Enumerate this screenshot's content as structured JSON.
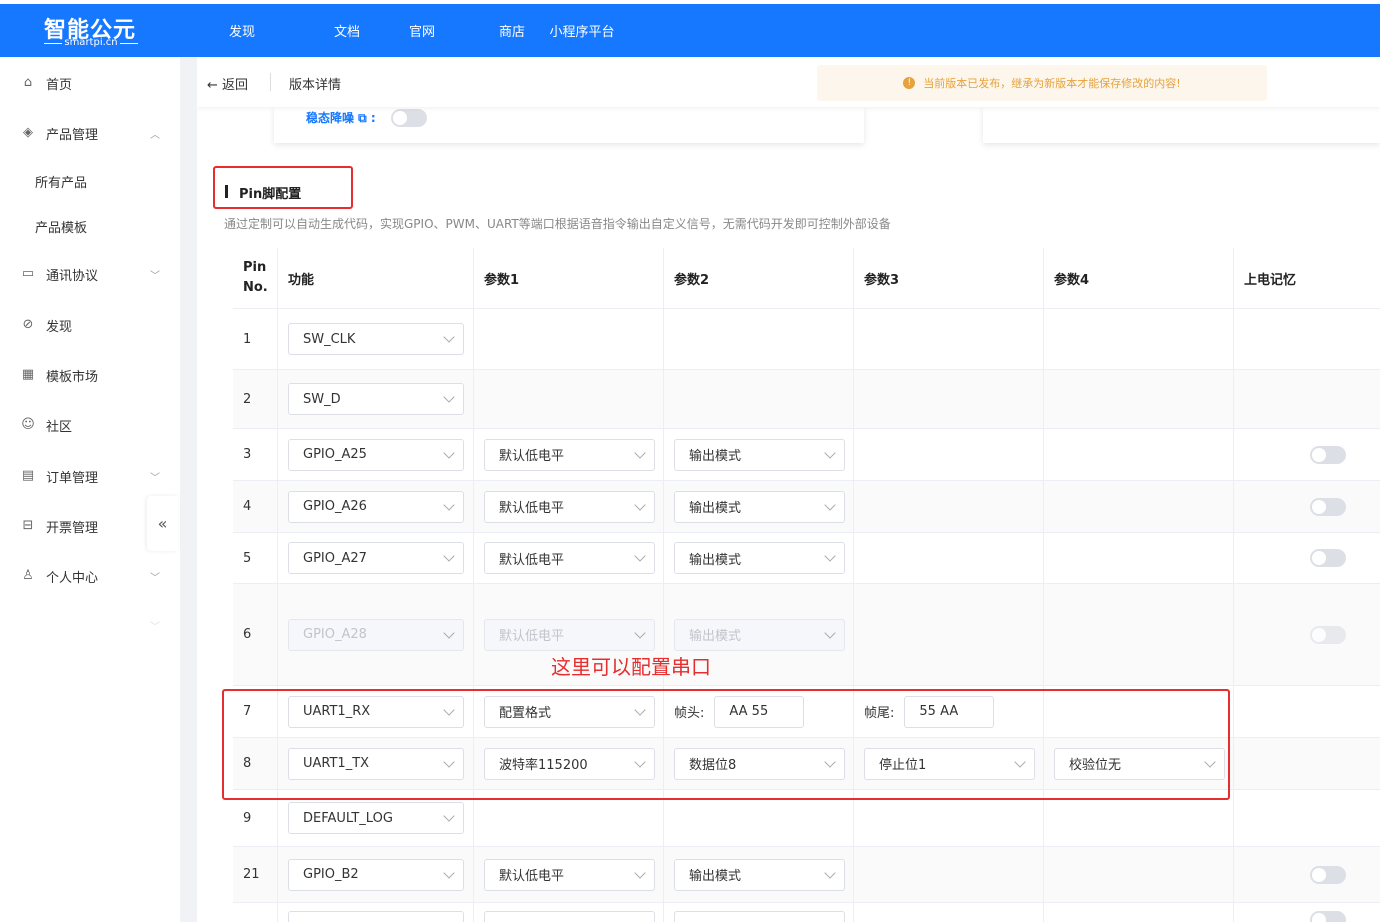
{
  "logo": {
    "main": "智能公元",
    "sub": "smartpi.cn"
  },
  "topnav": [
    "发现",
    "文档",
    "官网",
    "商店",
    "小程序平台"
  ],
  "sidebar": {
    "items": [
      {
        "label": "首页",
        "icon": "home-icon"
      },
      {
        "label": "产品管理",
        "icon": "layers-icon"
      },
      {
        "label": "所有产品"
      },
      {
        "label": "产品模板"
      },
      {
        "label": "通讯协议",
        "icon": "protocol-icon"
      },
      {
        "label": "发现",
        "icon": "compass-icon"
      },
      {
        "label": "模板市场",
        "icon": "grid-icon"
      },
      {
        "label": "社区",
        "icon": "chat-icon"
      },
      {
        "label": "订单管理",
        "icon": "order-icon"
      },
      {
        "label": "开票管理",
        "icon": "invoice-icon"
      },
      {
        "label": "个人中心",
        "icon": "user-icon"
      }
    ]
  },
  "header": {
    "back": "返回",
    "title": "版本详情",
    "notice": "当前版本已发布，继承为新版本才能保存修改的内容!"
  },
  "noise": {
    "label": "稳态降噪 ⧉ :"
  },
  "section": {
    "title": "Pin脚配置",
    "desc": "通过定制可以自动生成代码，实现GPIO、PWM、UART等端口根据语音指令输出自定义信号，无需代码开发即可控制外部设备"
  },
  "table": {
    "headers": {
      "pin": "Pin No.",
      "fn": "功能",
      "p1": "参数1",
      "p2": "参数2",
      "p3": "参数3",
      "p4": "参数4",
      "mem": "上电记忆"
    },
    "rows": [
      {
        "pin": "1",
        "fn": "SW_CLK"
      },
      {
        "pin": "2",
        "fn": "SW_D"
      },
      {
        "pin": "3",
        "fn": "GPIO_A25",
        "p1": "默认低电平",
        "p2": "输出模式"
      },
      {
        "pin": "4",
        "fn": "GPIO_A26",
        "p1": "默认低电平",
        "p2": "输出模式"
      },
      {
        "pin": "5",
        "fn": "GPIO_A27",
        "p1": "默认低电平",
        "p2": "输出模式"
      },
      {
        "pin": "6",
        "fn": "GPIO_A28",
        "p1": "默认低电平",
        "p2": "输出模式"
      },
      {
        "pin": "7",
        "fn": "UART1_RX",
        "p1": "配置格式",
        "p2_label": "帧头:",
        "p2_value": "AA 55",
        "p3_label": "帧尾:",
        "p3_value": "55 AA"
      },
      {
        "pin": "8",
        "fn": "UART1_TX",
        "p1": "波特率115200",
        "p2": "数据位8",
        "p3": "停止位1",
        "p4": "校验位无"
      },
      {
        "pin": "9",
        "fn": "DEFAULT_LOG"
      },
      {
        "pin": "21",
        "fn": "GPIO_B2",
        "p1": "默认低电平",
        "p2": "输出模式"
      }
    ]
  },
  "annotation": "这里可以配置串口"
}
